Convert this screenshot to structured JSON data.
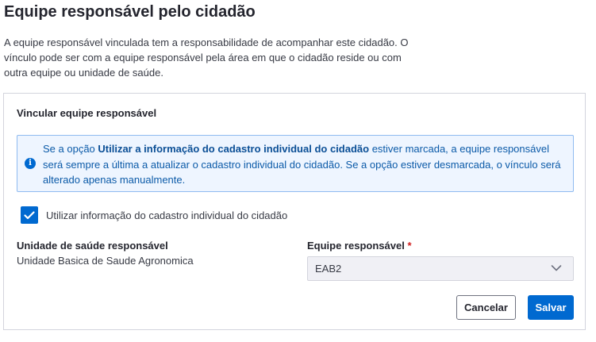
{
  "page": {
    "title": "Equipe responsável pelo cidadão",
    "description": "A equipe responsável vinculada tem a responsabilidade de acompanhar este cidadão. O vínculo pode ser com a equipe responsável pela área em que o cidadão reside ou com outra equipe ou unidade de saúde."
  },
  "card": {
    "title": "Vincular equipe responsável",
    "info": {
      "prefix": "Se a opção ",
      "emphasis": "Utilizar a informação do cadastro individual do cidadão",
      "suffix": " estiver marcada, a equipe responsável será sempre a última a atualizar o cadastro individual do cidadão. Se a opção estiver desmarcada, o vínculo será alterado apenas manualmente.",
      "icon": "info-icon"
    },
    "checkbox": {
      "label": "Utilizar informação do cadastro individual do cidadão",
      "checked": true
    },
    "unidade": {
      "label": "Unidade de saúde responsável",
      "value": "Unidade Basica de Saude Agronomica"
    },
    "equipe": {
      "label": "Equipe responsável",
      "required_mark": "*",
      "value": "EAB2"
    },
    "buttons": {
      "cancel": "Cancelar",
      "save": "Salvar"
    }
  },
  "colors": {
    "primary": "#0069d0",
    "info_bg": "#eef5ff",
    "info_border": "#8fbbf0",
    "required": "#d01e1e"
  }
}
